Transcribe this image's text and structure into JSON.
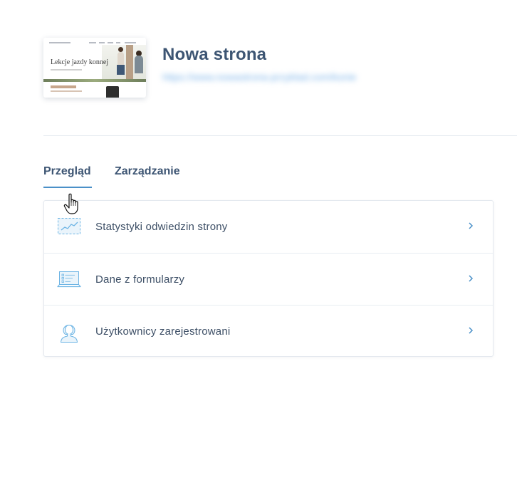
{
  "site": {
    "title": "Nowa strona",
    "url": "https://www.nowastrona-przyklad.com/konie",
    "thumbnail": {
      "hero_text": "Lekcje jazdy konnej"
    }
  },
  "tabs": [
    {
      "label": "Przegląd",
      "active": true
    },
    {
      "label": "Zarządzanie",
      "active": false
    }
  ],
  "menu": [
    {
      "label": "Statystyki odwiedzin strony",
      "icon": "stats-chart-icon"
    },
    {
      "label": "Dane z formularzy",
      "icon": "form-laptop-icon"
    },
    {
      "label": "Użytkownicy zarejestrowani",
      "icon": "user-icon"
    }
  ],
  "colors": {
    "accent": "#4a90c8",
    "title": "#3d5573",
    "text": "#3d4f66",
    "icon": "#6cb4e4",
    "divider": "#e6ebf0"
  }
}
